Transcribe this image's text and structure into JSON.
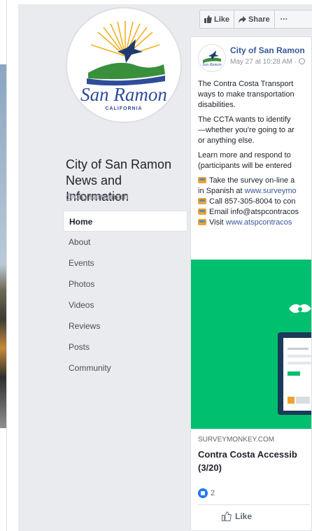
{
  "sidebar": {
    "page_name": "City of San Ramon News and Information",
    "handle": "@citysanramon",
    "nav": [
      "Home",
      "About",
      "Events",
      "Photos",
      "Videos",
      "Reviews",
      "Posts",
      "Community"
    ],
    "logo_text": "San Ramon",
    "logo_subtext": "CALIFORNIA"
  },
  "actions": {
    "like": "Like",
    "share": "Share",
    "more": "···"
  },
  "post": {
    "author": "City of San Ramon",
    "meta": "May 27 at 10:28 AM · ",
    "avatar_text": "San Ramon",
    "lines": [
      "The Contra Costa Transport",
      "ways to make transportation",
      "disabilities.",
      "The CCTA wants to identify",
      "—whether you're going to ar",
      "or anything else.",
      "Learn more and respond to",
      "(participants will be entered",
      "Take the survey on-line a",
      "in Spanish at ",
      "www.surveymo",
      "Call 857-305-8004 to con",
      "Email info@atspcontracos",
      "Visit ",
      "www.atspcontracos"
    ],
    "link_domain": "SURVEYMONKEY.COM",
    "link_title_1": "Contra Costa Accessib",
    "link_title_2": "(3/20)",
    "reaction_count": "2",
    "like_action": "Like"
  },
  "colors": {
    "accent": "#385898",
    "survey_green": "#00bf6f"
  }
}
